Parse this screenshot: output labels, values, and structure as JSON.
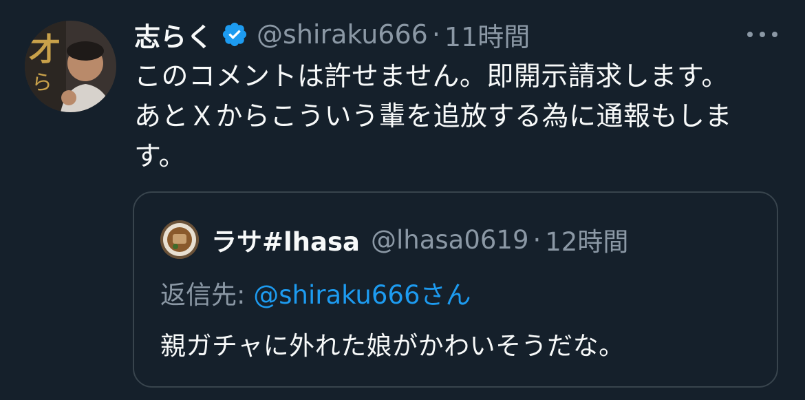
{
  "tweet": {
    "author": {
      "display_name": "志らく",
      "verified_icon": "verified-badge-icon",
      "handle": "@shiraku666",
      "separator": "·",
      "time": "11時間"
    },
    "more_icon": "more-options-icon",
    "body_lines": [
      "このコメントは許せません。即開示請求します。",
      "あとＸからこういう輩を追放する為に通報もしま",
      "す。"
    ]
  },
  "quoted_tweet": {
    "author": {
      "display_name": "ラサ#lhasa",
      "handle": "@lhasa0619",
      "separator": "·",
      "time": "12時間"
    },
    "reply_to": {
      "label": "返信先: ",
      "handle": "@shiraku666",
      "suffix": "さん"
    },
    "text": "親ガチャに外れた娘がかわいそうだな。"
  },
  "colors": {
    "background": "#15202b",
    "text_primary": "#f7f9f9",
    "text_secondary": "#8b98a5",
    "accent": "#1d9bf0",
    "border": "#38444d"
  }
}
